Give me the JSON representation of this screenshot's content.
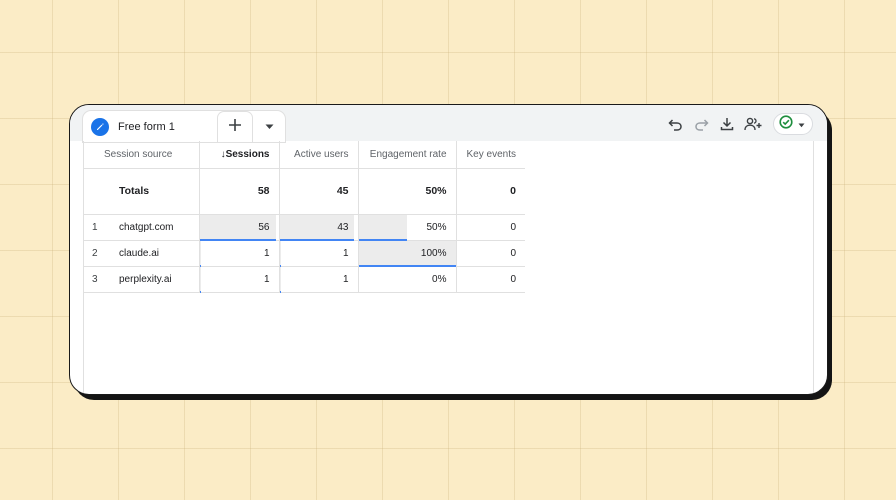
{
  "tab": {
    "label": "Free form 1"
  },
  "toolbar": {
    "icons": [
      "undo-icon",
      "redo-icon",
      "download-icon",
      "share-icon",
      "check-circle-icon",
      "chevron-down-icon"
    ]
  },
  "colors": {
    "background": "#fbecc6",
    "accent": "#1a73e8",
    "bar_line": "#4285f4",
    "bar_fill": "#ececec",
    "status_green": "#1e8e3e"
  },
  "table": {
    "headers": {
      "session_source": "Session source",
      "sessions": "Sessions",
      "active_users": "Active users",
      "engagement_rate": "Engagement rate",
      "key_events": "Key events"
    },
    "sort_indicator": "↓",
    "totals": {
      "label": "Totals",
      "sessions": "58",
      "active_users": "45",
      "engagement_rate": "50%",
      "key_events": "0"
    },
    "rows": [
      {
        "index": "1",
        "source": "chatgpt.com",
        "sessions": "56",
        "active_users": "43",
        "engagement_rate": "50%",
        "key_events": "0"
      },
      {
        "index": "2",
        "source": "claude.ai",
        "sessions": "1",
        "active_users": "1",
        "engagement_rate": "100%",
        "key_events": "0"
      },
      {
        "index": "3",
        "source": "perplexity.ai",
        "sessions": "1",
        "active_users": "1",
        "engagement_rate": "0%",
        "key_events": "0"
      }
    ],
    "bars": {
      "sessions_fraction": [
        0.9655,
        0.0172,
        0.0172
      ],
      "active_users_fraction": [
        0.9556,
        0.0222,
        0.0222
      ],
      "engagement_rate_fraction": [
        0.5,
        1.0,
        0.0
      ]
    }
  }
}
